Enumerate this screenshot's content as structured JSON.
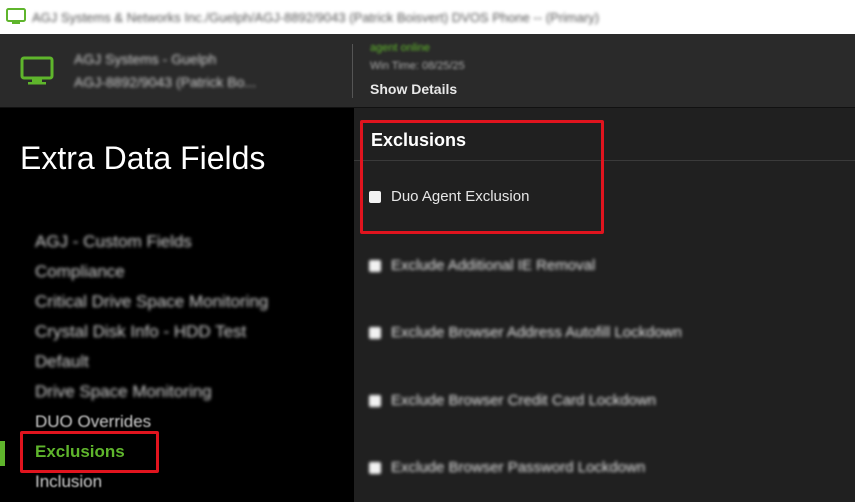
{
  "window": {
    "title": "AGJ Systems & Networks Inc./Guelph/AGJ-8892/9043 (Patrick Boisvert) DVOS Phone -- (Primary)",
    "icon": "monitor-icon"
  },
  "header": {
    "device_name": "AGJ Systems - Guelph",
    "device_sub": "AGJ-8892/9043 (Patrick Bo...",
    "status": "agent online",
    "time": "Win Time: 08/25/25",
    "show_details": "Show Details",
    "accent": "#5fb52c"
  },
  "sidebar": {
    "title": "Extra Data Fields",
    "items": [
      {
        "label": "AGJ - Custom Fields"
      },
      {
        "label": "Compliance"
      },
      {
        "label": "Critical Drive Space Monitoring"
      },
      {
        "label": "Crystal Disk Info - HDD Test"
      },
      {
        "label": "Default"
      },
      {
        "label": "Drive Space Monitoring"
      },
      {
        "label": "DUO Overrides"
      },
      {
        "label": "Exclusions"
      },
      {
        "label": "Inclusion"
      }
    ],
    "active_index": 7
  },
  "main": {
    "section_title": "Exclusions",
    "options": [
      {
        "label": "Duo Agent Exclusion",
        "checked": false
      },
      {
        "label": "Exclude Additional IE Removal",
        "checked": false
      },
      {
        "label": "Exclude Browser Address Autofill Lockdown",
        "checked": false
      },
      {
        "label": "Exclude Browser Credit Card Lockdown",
        "checked": false
      },
      {
        "label": "Exclude Browser Password Lockdown",
        "checked": false
      }
    ]
  },
  "colors": {
    "highlight": "#e0141e",
    "active_nav": "#5fb52c"
  }
}
